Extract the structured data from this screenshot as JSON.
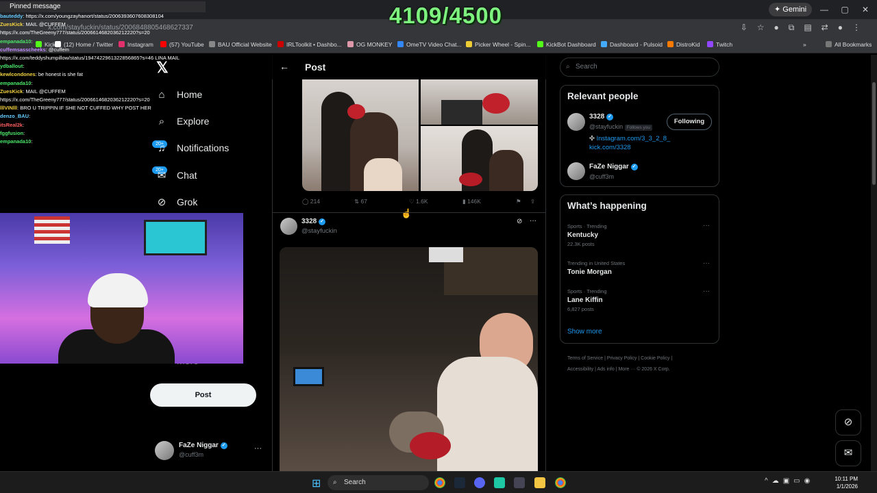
{
  "browser": {
    "url": "x.com/stayfuckin/status/2006848805468627337",
    "gemini": "Gemini",
    "bookmarks": [
      "Kick",
      "(12) Home / Twitter",
      "Instagram",
      "(57) YouTube",
      "BAU Official Website",
      "IRLToolkit • Dashbo...",
      "OG MONKEY",
      "OmeTV Video Chat...",
      "Picker Wheel - Spin...",
      "KickBot Dashboard",
      "Dashboard - Pulsoid",
      "DistroKid",
      "Twitch"
    ],
    "all_bookmarks": "All Bookmarks"
  },
  "overlay": {
    "counter": "4109/4500",
    "pinned": "Pinned message",
    "chat": [
      {
        "user": "bauteddy",
        "msg": "https://x.com/youngzayhanort/status/2006393607608308104",
        "c": "n5"
      },
      {
        "user": "ZuesKick",
        "msg": "MAIL @CUFFEM",
        "c": "n1"
      },
      {
        "user": "",
        "msg": "https://x.com/TheGreeny777/status/2006614682036212220?s=20",
        "c": ""
      },
      {
        "user": "empanada10",
        "msg": "",
        "c": "n2"
      },
      {
        "user": "cuffemsasscheeks",
        "msg": "@cuffem",
        "c": "n3"
      },
      {
        "user": "",
        "msg": "https://x.com/teddyshumpillow/status/1947422961322856865?s=46 LINA MAIL",
        "c": ""
      },
      {
        "user": "ydballout",
        "msg": "",
        "c": "n2"
      },
      {
        "user": "kewlcondones",
        "msg": "be honest is she fat",
        "c": "n1"
      },
      {
        "user": "empanada10",
        "msg": "",
        "c": "n2"
      },
      {
        "user": "ZuesKick",
        "msg": "MAIL @CUFFEM",
        "c": "n1"
      },
      {
        "user": "",
        "msg": "https://x.com/TheGreeny777/status/2006614682036212220?s=20",
        "c": ""
      },
      {
        "user": "lllVINlll",
        "msg": "BRO U TRIPPIN IF SHE NOT CUFFED WHY POST HER",
        "c": "n1"
      },
      {
        "user": "denzo_BAU",
        "msg": "",
        "c": "n5"
      },
      {
        "user": "itsReal2k",
        "msg": "",
        "c": "n4"
      },
      {
        "user": "fggfusion",
        "msg": "",
        "c": "n2"
      },
      {
        "user": "empanada10",
        "msg": "",
        "c": "n2"
      }
    ]
  },
  "nav": {
    "items": [
      {
        "label": "Home",
        "icon": "home-icon",
        "glyph": "⌂"
      },
      {
        "label": "Explore",
        "icon": "search-icon",
        "glyph": "⌕"
      },
      {
        "label": "Notifications",
        "icon": "bell-icon",
        "glyph": "🔔"
      },
      {
        "label": "Chat",
        "icon": "chat-icon",
        "glyph": "✉"
      },
      {
        "label": "Grok",
        "icon": "grok-icon",
        "glyph": "⊘"
      }
    ],
    "badge": "20+",
    "more": "More",
    "post_button": "Post",
    "account": {
      "name": "FaZe Niggar",
      "handle": "@cuff3m"
    }
  },
  "main": {
    "header": "Post",
    "stats": {
      "replies": "214",
      "reposts": "67",
      "likes": "1.6K",
      "views": "146K"
    },
    "reply": {
      "name": "3328",
      "handle": "@stayfuckin"
    }
  },
  "right": {
    "search_placeholder": "Search",
    "relevant": {
      "title": "Relevant people",
      "people": [
        {
          "name": "3328",
          "handle": "@stayfuckin",
          "follows": "Follows you",
          "bio_link": "Instagram.com/3_3_2_8_",
          "bio_link2": "kick.com/3328",
          "button": "Following"
        },
        {
          "name": "FaZe Niggar",
          "handle": "@cuff3m"
        }
      ]
    },
    "happening": {
      "title": "What’s happening",
      "trends": [
        {
          "meta": "Sports · Trending",
          "name": "Kentucky",
          "posts": "22.3K posts"
        },
        {
          "meta": "Trending in United States",
          "name": "Tonie Morgan",
          "posts": ""
        },
        {
          "meta": "Sports · Trending",
          "name": "Lane Kiffin",
          "posts": "6,827 posts"
        }
      ],
      "show_more": "Show more"
    },
    "footer": [
      "Terms of Service",
      "Privacy Policy",
      "Cookie Policy",
      "Accessibility",
      "Ads info",
      "More ···",
      "© 2026 X Corp."
    ]
  },
  "taskbar": {
    "search": "Search",
    "time": "10:11 PM",
    "date": "1/1/2026"
  }
}
